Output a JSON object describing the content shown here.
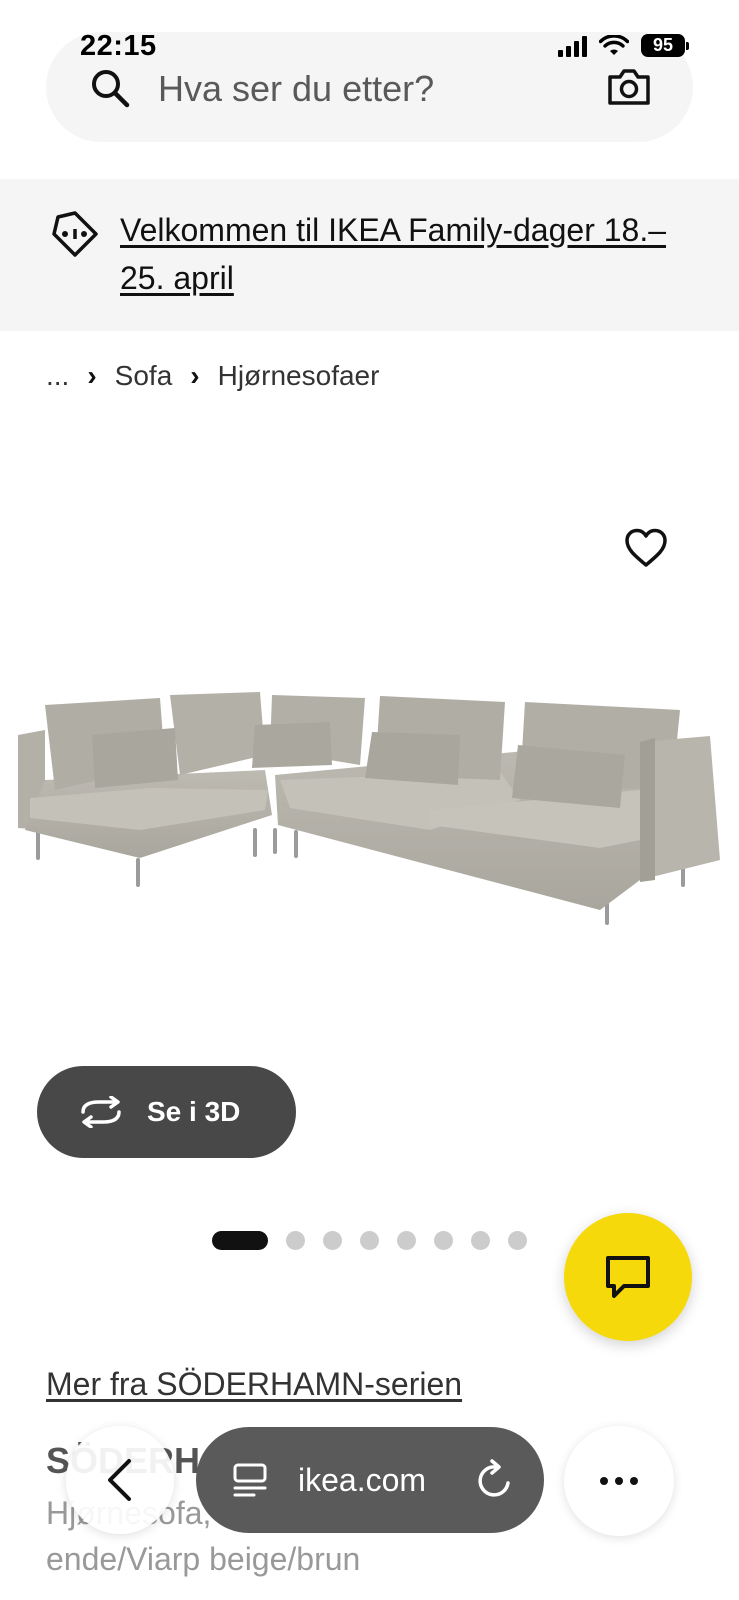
{
  "status_bar": {
    "time": "22:15",
    "battery": "95",
    "signal_icon": "cellular-signal-icon",
    "wifi_icon": "wifi-icon"
  },
  "search": {
    "placeholder": "Hva ser du etter?",
    "search_icon": "search-icon",
    "camera_icon": "camera-icon"
  },
  "banner": {
    "text": "Velkommen til IKEA Family-dager 18.–25. april",
    "icon": "price-tag-icon"
  },
  "breadcrumb": {
    "ellipsis": "...",
    "items": [
      "Sofa",
      "Hjørnesofaer"
    ]
  },
  "product": {
    "image_alt": "sofa-image",
    "view_3d_label": "Se i 3D",
    "pager": {
      "total": 8,
      "active_index": 0
    },
    "series_link": "Mer fra SÖDERHAMN-serien",
    "name": "SÖDERHAMN",
    "description": "Hjørnesofa, 4-seters, med åpen ende/Viarp beige/brun"
  },
  "browser": {
    "url": "ikea.com",
    "back_icon": "back-chevron-icon",
    "reload_icon": "reload-icon",
    "more_icon": "more-dots-icon"
  },
  "colors": {
    "accent_yellow": "#f5d90a",
    "surface_grey": "#f5f5f5",
    "dark_button": "#484848"
  }
}
